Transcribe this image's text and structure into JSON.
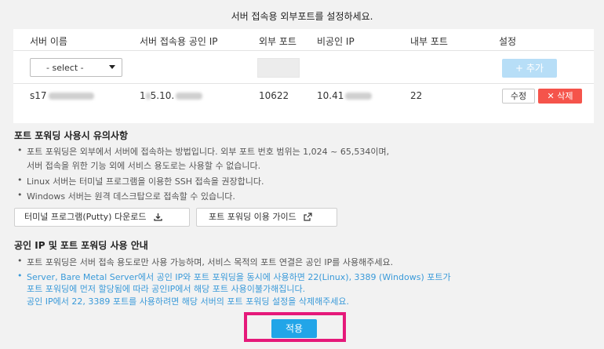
{
  "heading": "서버 접속용 외부포트를 설정하세요.",
  "table": {
    "headers": [
      "서버 이름",
      "서버 접속용 공인 IP",
      "외부 포트",
      "비공인 IP",
      "내부 포트",
      "설정"
    ],
    "select_label": "- select -",
    "add_label": "+ 추가",
    "row": {
      "server_name": "s17",
      "public_ip_a": "1",
      "public_ip_b": "5.10.",
      "external_port": "10622",
      "private_ip": "10.41",
      "internal_port": "22",
      "edit_label": "수정",
      "delete_label": "✕ 삭제"
    }
  },
  "forwarding": {
    "title": "포트 포워딩 사용시 유의사항",
    "notes": [
      "포트 포워딩은 외부에서 서버에 접속하는 방법입니다. 외부 포트 번호 범위는 1,024 ~ 65,534이며,",
      "서버 접속을 위한 기능 외에 서비스 용도로는 사용할 수 없습니다.",
      "Linux 서버는 터미널 프로그램을 이용한 SSH 접속을 권장합니다.",
      "Windows 서버는 원격 데스크탑으로 접속할 수 있습니다."
    ],
    "download_label": "터미널 프로그램(Putty) 다운로드",
    "guide_label": "포트 포워딩 이용 가이드"
  },
  "ip_guide": {
    "title": "공인 IP 및 포트 포워딩 사용 안내",
    "notes": [
      "포트 포워딩은 서버 접속 용도로만 사용 가능하며, 서비스 목적의 포트 연결은 공인 IP를 사용해주세요.",
      "Server, Bare Metal Server에서 공인 IP와 포트 포워딩을 동시에 사용하면 22(Linux), 3389 (Windows) 포트가",
      "포트 포워딩에 먼저 할당됨에 따라 공인IP에서 해당 포트 사용이불가해집니다.",
      "공인 IP에서 22, 3389 포트를 사용하려면 해당 서버의 포트 포워딩 설정을 삭제해주세요."
    ]
  },
  "apply_label": "적용",
  "colors": {
    "delete": "#f5544b",
    "add_disabled": "#b7def7",
    "apply": "#22a5e8",
    "highlight": "#e5197a",
    "info_blue": "#3a9ad9"
  },
  "icons": [
    "download-icon",
    "external-link-icon",
    "close-icon",
    "plus-icon",
    "chevron-down-icon"
  ]
}
